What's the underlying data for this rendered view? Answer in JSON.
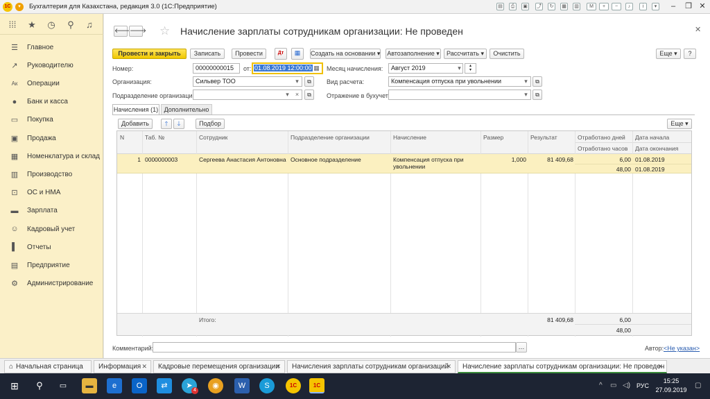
{
  "window": {
    "title": "Бухгалтерия для Казахстана, редакция 3.0  (1С:Предприятие)",
    "logo_text": "1С"
  },
  "nav": {
    "items": [
      {
        "label": "Главное",
        "icon": "menu-lines-icon"
      },
      {
        "label": "Руководителю",
        "icon": "trend-icon"
      },
      {
        "label": "Операции",
        "icon": "operations-icon"
      },
      {
        "label": "Банк и касса",
        "icon": "bank-icon"
      },
      {
        "label": "Покупка",
        "icon": "cart-icon"
      },
      {
        "label": "Продажа",
        "icon": "sale-icon"
      },
      {
        "label": "Номенклатура и склад",
        "icon": "warehouse-icon"
      },
      {
        "label": "Производство",
        "icon": "factory-icon"
      },
      {
        "label": "ОС и НМА",
        "icon": "assets-icon"
      },
      {
        "label": "Зарплата",
        "icon": "salary-icon"
      },
      {
        "label": "Кадровый учет",
        "icon": "people-icon"
      },
      {
        "label": "Отчеты",
        "icon": "reports-icon"
      },
      {
        "label": "Предприятие",
        "icon": "enterprise-icon"
      },
      {
        "label": "Администрирование",
        "icon": "gear-icon"
      }
    ]
  },
  "doc": {
    "title": "Начисление зарплаты сотрудникам организации: Не проведен",
    "toolbar": {
      "post_close": "Провести и закрыть",
      "save": "Записать",
      "post": "Провести",
      "create_based": "Создать на основании",
      "autofill": "Автозаполнение",
      "calculate": "Рассчитать",
      "clear": "Очистить",
      "more": "Еще",
      "help": "?"
    },
    "fields": {
      "number_label": "Номер:",
      "number_value": "00000000015",
      "from_label": "от:",
      "date_value": "01.08.2019 12:00:00",
      "month_label": "Месяц начисления:",
      "month_value": "Август 2019",
      "org_label": "Организация:",
      "org_value": "Сильвер ТОО",
      "calc_type_label": "Вид расчета:",
      "calc_type_value": "Компенсация отпуска при увольнении",
      "dept_label": "Подразделение организации:",
      "dept_value": "",
      "reflect_label": "Отражение в бухучете:",
      "reflect_value": ""
    },
    "tabs": {
      "charges": "Начисления (1)",
      "additional": "Дополнительно"
    },
    "table_toolbar": {
      "add": "Добавить",
      "select": "Подбор",
      "more": "Еще"
    },
    "table": {
      "headers": {
        "n": "N",
        "tab_no": "Таб. №",
        "employee": "Сотрудник",
        "department": "Подразделение организации",
        "accrual": "Начисление",
        "size": "Размер",
        "result": "Результат",
        "days_worked": "Отработано дней",
        "hours_worked": "Отработано часов",
        "start_date": "Дата начала",
        "end_date": "Дата окончания"
      },
      "rows": [
        {
          "n": "1",
          "tab_no": "0000000003",
          "employee": "Сергеева Анастасия Антоновна",
          "department": "Основное подразделение",
          "accrual_line1": "Компенсация отпуска при",
          "accrual_line2": "увольнении",
          "size": "1,000",
          "result": "81 409,68",
          "days_worked": "6,00",
          "hours_worked": "48,00",
          "start_date": "01.08.2019",
          "end_date": "01.08.2019"
        }
      ],
      "footer": {
        "total_label": "Итого:",
        "result": "81 409,68",
        "days": "6,00",
        "hours": "48,00"
      }
    },
    "comment_label": "Комментарий:",
    "comment_value": "",
    "author_label": "Автор:",
    "author_value": "<Не указан>"
  },
  "open_tabs": [
    {
      "label": "Начальная страница"
    },
    {
      "label": "Информация"
    },
    {
      "label": "Кадровые перемещения организации"
    },
    {
      "label": "Начисления зарплаты сотрудникам организаций"
    },
    {
      "label": "Начисление зарплаты сотрудникам организации: Не проведен"
    }
  ],
  "taskbar": {
    "lang": "РУС",
    "time": "15:25",
    "date": "27.09.2019",
    "badge": "4"
  },
  "colors": {
    "nav_bg": "#fbf0c8",
    "primary_button": "#f0c800",
    "selected_row": "#fbf0c0",
    "active_tab_accent": "#3a8a3a",
    "taskbar": "#1d2433"
  }
}
